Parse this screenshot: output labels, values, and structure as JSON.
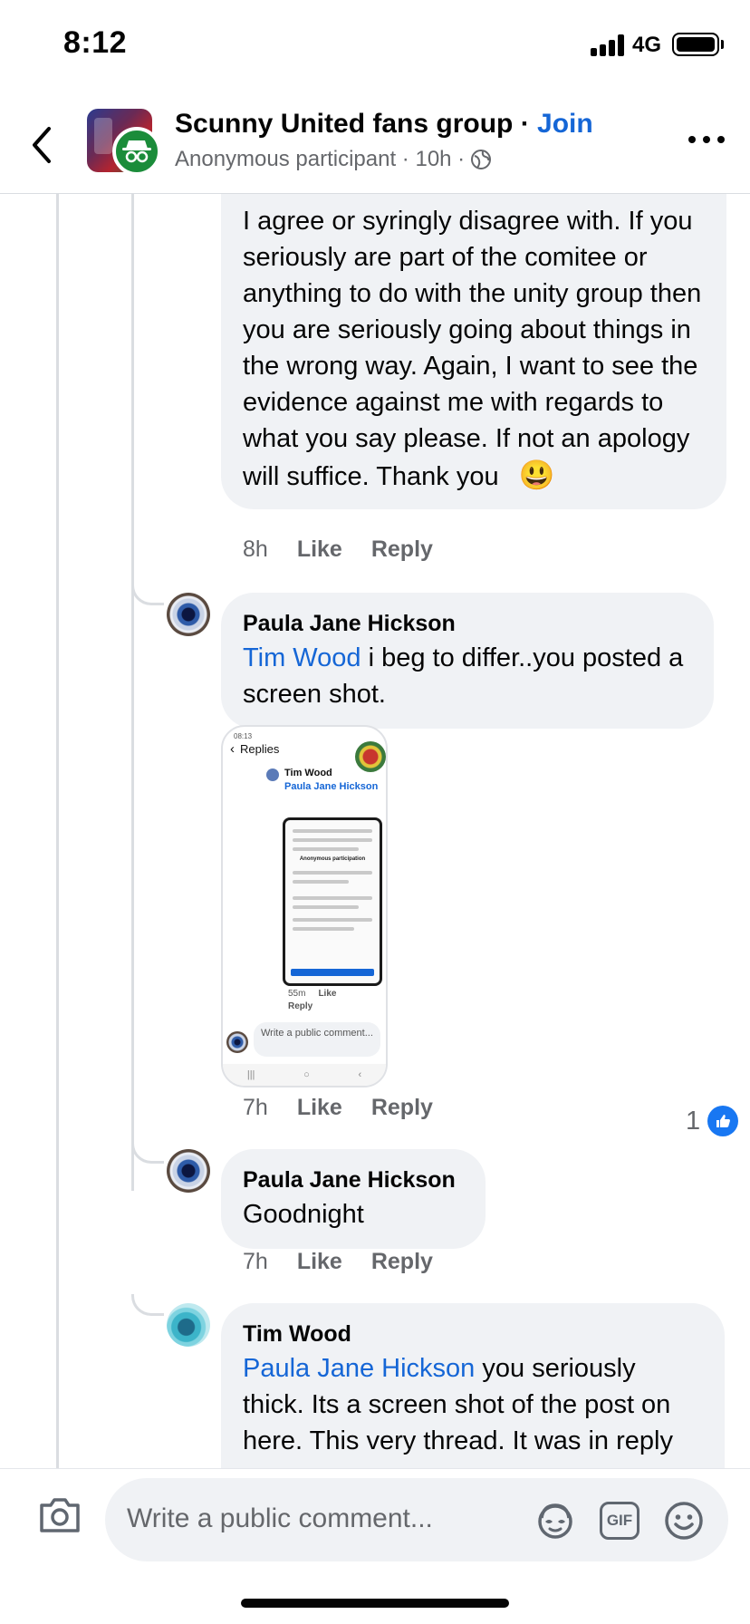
{
  "status_bar": {
    "time": "8:12",
    "network": "4G"
  },
  "header": {
    "group_name": "Scunny United fans group",
    "separator": " · ",
    "join_label": "Join",
    "subtitle": "Anonymous participant · 10h ·"
  },
  "comments": [
    {
      "text": "I agree or syringly disagree with. If you seriously are part of the comitee or anything to do with the unity group then you are seriously going about things in the wrong way. Again, I want to see the evidence against me with regards to what you say please. If not an apology will suffice. Thank you",
      "emoji": "😃",
      "time": "8h",
      "like": "Like",
      "reply": "Reply"
    },
    {
      "author": "Paula Jane Hickson",
      "mention": "Tim Wood",
      "text": " i beg to differ..you posted a screen shot.",
      "time": "7h",
      "like": "Like",
      "reply": "Reply",
      "reaction_count": "1"
    },
    {
      "author": "Paula Jane Hickson",
      "text": "Goodnight",
      "time": "7h",
      "like": "Like",
      "reply": "Reply"
    },
    {
      "author": "Tim Wood",
      "mention": "Paula Jane Hickson",
      "text": " you seriously thick. Its a screen shot of the post on here. This very thread. It was in reply"
    }
  ],
  "attachment": {
    "status": "08:13",
    "header": "Replies",
    "inner_name": "Tim Wood",
    "inner_mention": "Paula Jane Hickson",
    "inner_title": "Anonymous participation",
    "inner_time": "55m",
    "inner_like": "Like",
    "inner_reply": "Reply",
    "inner_input": "Write a public comment..."
  },
  "composer": {
    "placeholder": "Write a public comment...",
    "gif_label": "GIF"
  },
  "icons": [
    "back-icon",
    "globe-icon",
    "more-icon",
    "camera-icon",
    "avatar-sticker-icon",
    "gif-icon",
    "emoji-icon",
    "thumbs-up-icon"
  ],
  "colors": {
    "link": "#1566d6",
    "bubble": "#f0f2f5",
    "meta": "#65676b",
    "like_blue": "#1877f2"
  }
}
